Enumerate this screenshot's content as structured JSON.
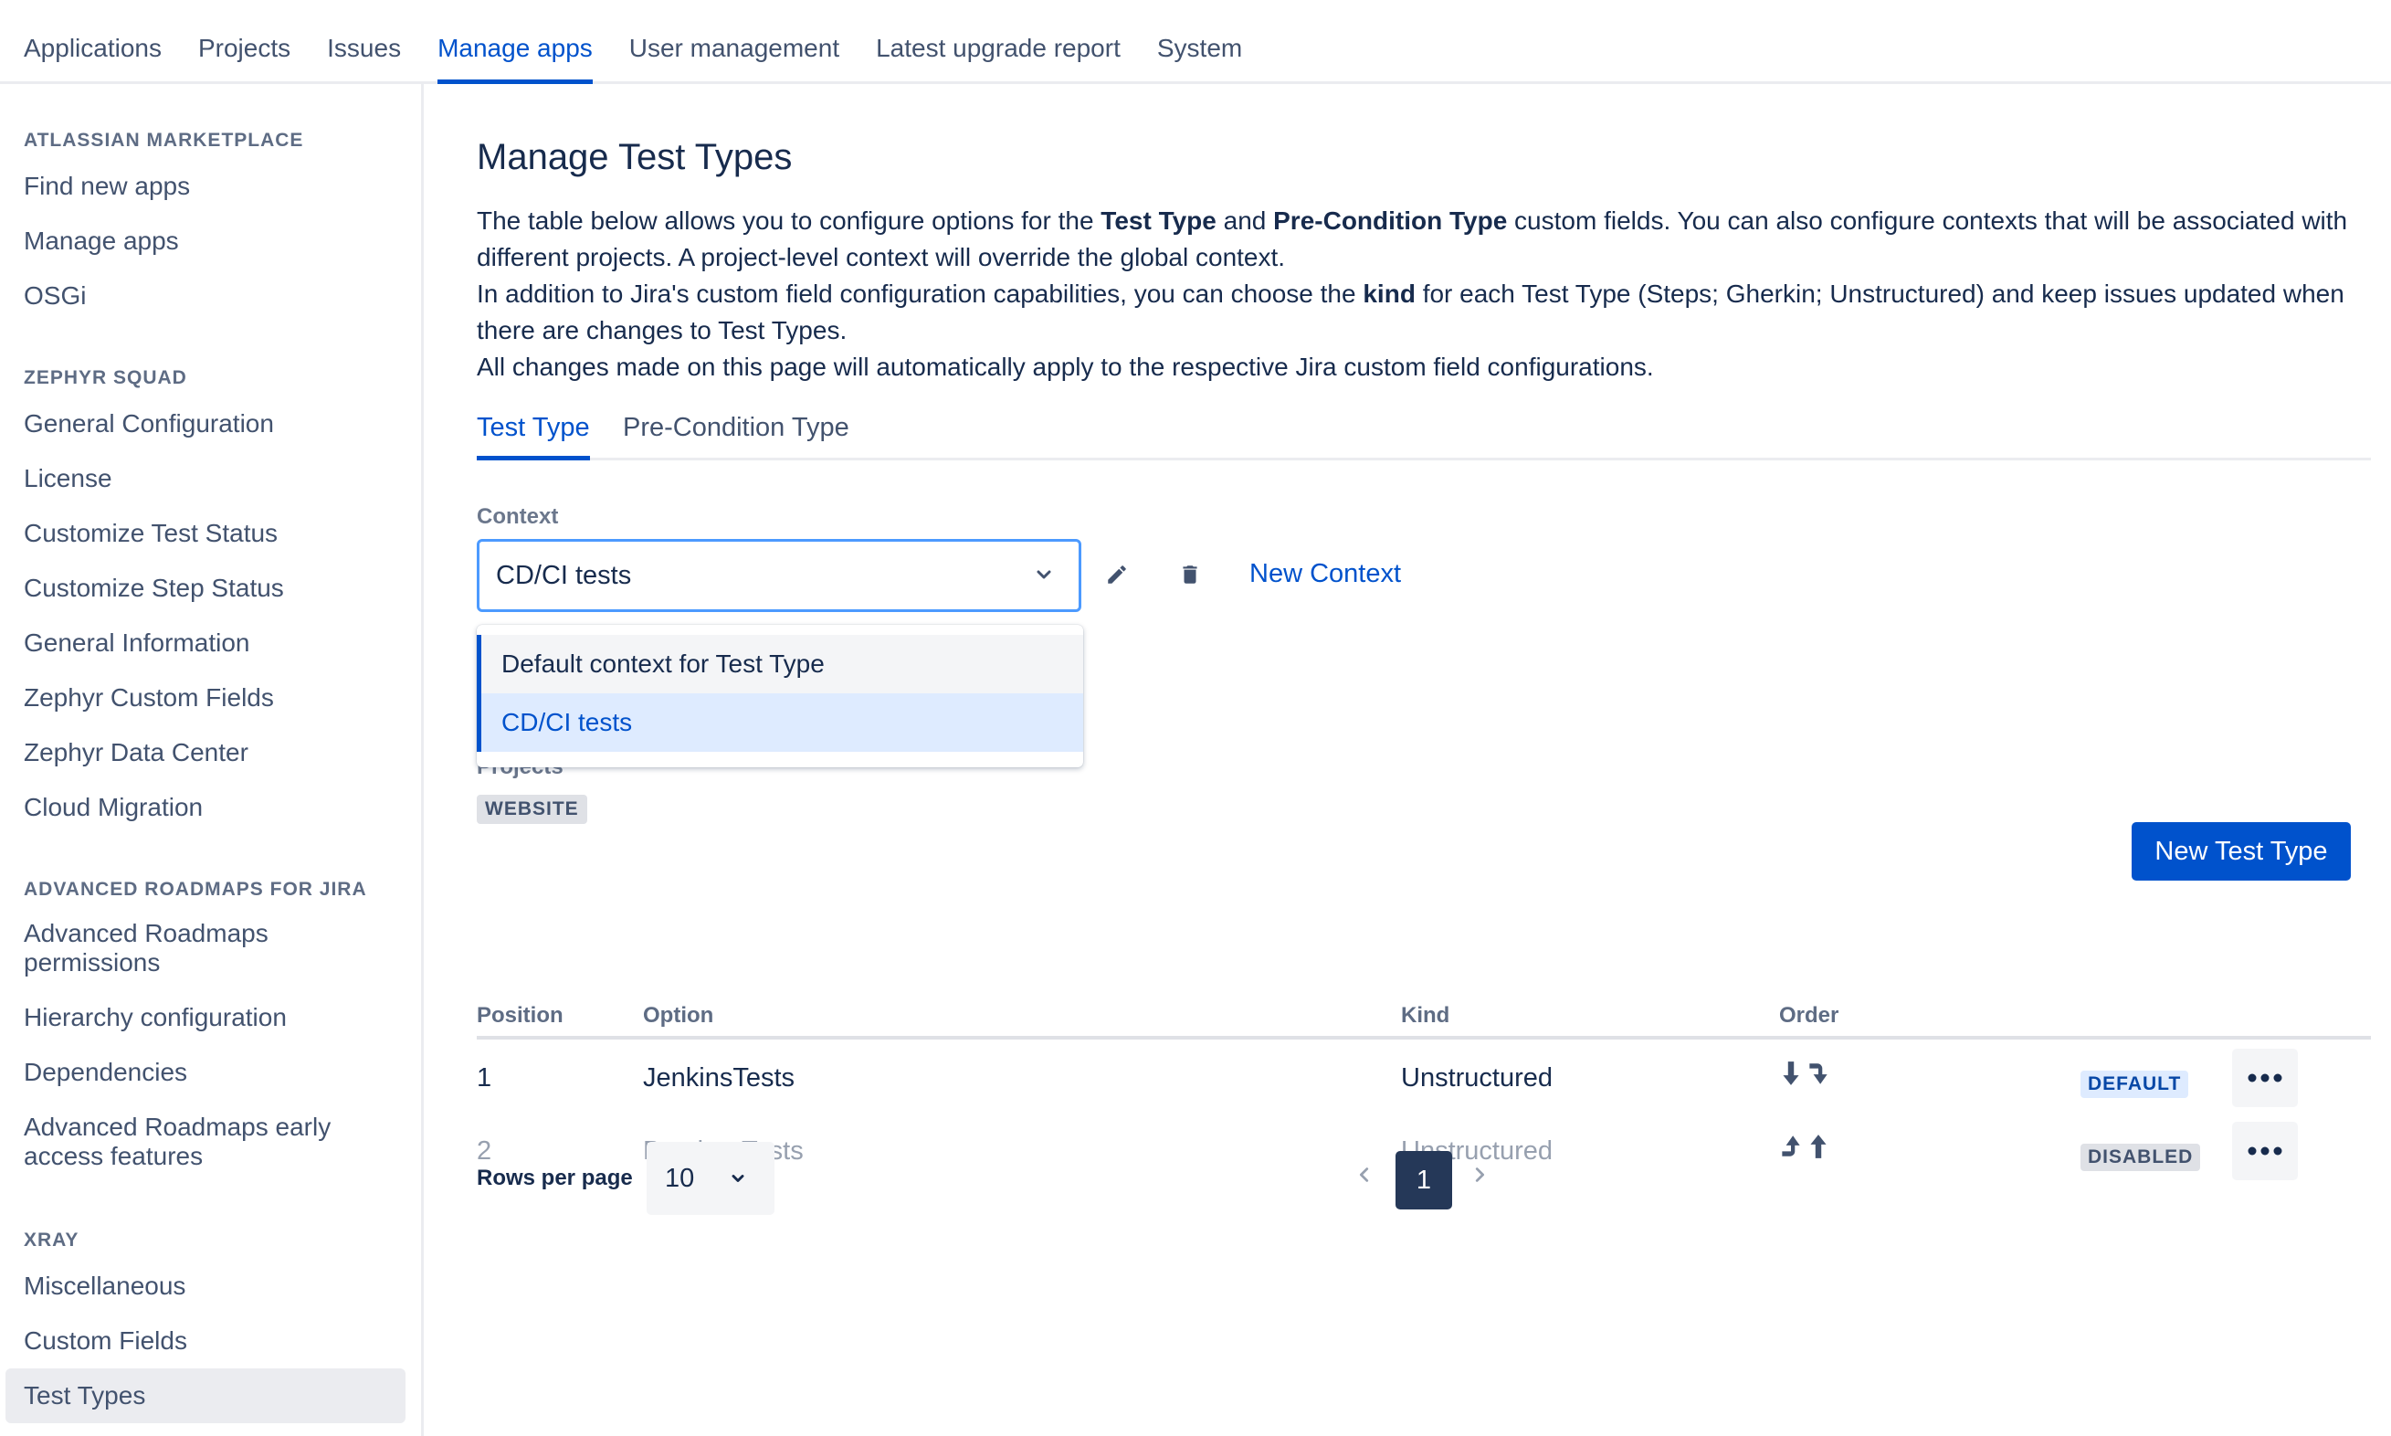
{
  "topnav": {
    "tabs": [
      {
        "label": "Applications"
      },
      {
        "label": "Projects"
      },
      {
        "label": "Issues"
      },
      {
        "label": "Manage apps"
      },
      {
        "label": "User management"
      },
      {
        "label": "Latest upgrade report"
      },
      {
        "label": "System"
      }
    ],
    "active": "Manage apps"
  },
  "sidebar": {
    "sections": [
      {
        "heading": "ATLASSIAN MARKETPLACE",
        "items": [
          "Find new apps",
          "Manage apps",
          "OSGi"
        ]
      },
      {
        "heading": "ZEPHYR SQUAD",
        "items": [
          "General Configuration",
          "License",
          "Customize Test Status",
          "Customize Step Status",
          "General Information",
          "Zephyr Custom Fields",
          "Zephyr Data Center",
          "Cloud Migration"
        ]
      },
      {
        "heading": "ADVANCED ROADMAPS FOR JIRA",
        "items": [
          "Advanced Roadmaps permissions",
          "Hierarchy configuration",
          "Dependencies",
          "Advanced Roadmaps early access features"
        ]
      },
      {
        "heading": "XRAY",
        "items": [
          "Miscellaneous",
          "Custom Fields",
          "Test Types"
        ]
      }
    ],
    "selected": "Test Types"
  },
  "main": {
    "title": "Manage Test Types",
    "desc": {
      "l1_a": "The table below allows you to configure options for the ",
      "l1_b": "Test Type",
      "l1_c": " and ",
      "l1_d": "Pre-Condition Type",
      "l1_e": " custom fields. You can also configure contexts that will be associated with different projects. A project-level context will override the global context.",
      "l2_a": "In addition to Jira's custom field configuration capabilities, you can choose the ",
      "l2_b": "kind",
      "l2_c": " for each Test Type (Steps; Gherkin; Unstructured) and keep issues updated when there are changes to Test Types.",
      "l3": "All changes made on this page will automatically apply to the respective Jira custom field configurations."
    },
    "subtabs": {
      "test_type": "Test Type",
      "precondition_type": "Pre-Condition Type"
    },
    "context": {
      "label": "Context",
      "value": "CD/CI tests",
      "new_context": "New Context",
      "options": [
        "Default context for Test Type",
        "CD/CI tests"
      ]
    },
    "projects_label": "Projects",
    "project_badge": "WEBSITE",
    "new_test_type": "New Test Type",
    "table": {
      "headers": {
        "position": "Position",
        "option": "Option",
        "kind": "Kind",
        "order": "Order"
      },
      "rows": [
        {
          "position": "1",
          "option": "JenkinsTests",
          "kind": "Unstructured",
          "status": "DEFAULT"
        },
        {
          "position": "2",
          "option": "BambooTests",
          "kind": "Unstructured",
          "status": "DISABLED"
        }
      ]
    },
    "pagination": {
      "rows_label": "Rows per page",
      "rows_value": "10",
      "current_page": "1"
    }
  },
  "colors": {
    "brand": "#0052cc",
    "text": "#172b4d",
    "muted": "#42526e",
    "page_selected": "#253858"
  }
}
